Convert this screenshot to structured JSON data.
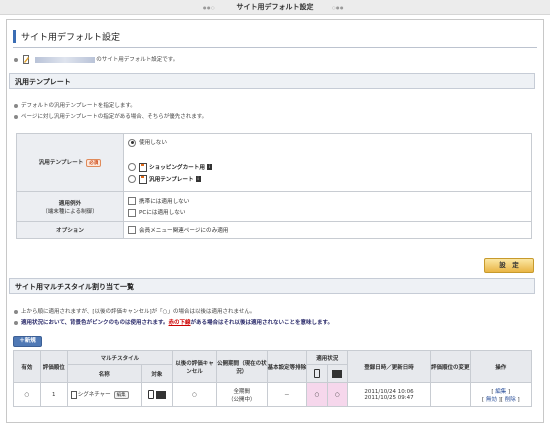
{
  "window": {
    "title": "サイト用デフォルト設定"
  },
  "main": {
    "title": "サイト用デフォルト設定",
    "intro_suffix": "のサイト用デフォルト設定です。"
  },
  "template_section": {
    "heading": "汎用テンプレート",
    "notes": [
      "デフォルトの汎用テンプレートを指定します。",
      "ページに対し汎用テンプレートの指定がある場合、そちらが優先されます。"
    ],
    "template_label": "汎用テンプレート",
    "required_badge": "必須",
    "radio_none": "使用しない",
    "radio_shopping": "ショッピングカート用",
    "radio_generic": "汎用テンプレート",
    "exclusion_label": "適用例外",
    "exclusion_sublabel": "（端末種による制御）",
    "exclude_mobile": "携帯には適用しない",
    "exclude_pc": "PCには適用しない",
    "option_label": "オプション",
    "option_text": "会員メニュー関連ページにのみ適用",
    "setting_button": "設　定"
  },
  "multistyle_section": {
    "heading": "サイト用マルチスタイル割り当て一覧",
    "note1": "上から順に適用されますが、[以後の評価キャンセル]が「○」の場合は以後は適用されません。",
    "note2_prefix": "適用状況において、背景色がピンクのものは使用されます。",
    "note2_highlight": "赤の下線",
    "note2_suffix": "がある場合はそれ以後は適用されないことを意味します。",
    "new_button": "＋新規",
    "columns": {
      "enabled": "有効",
      "order": "評価順位",
      "multistyle": "マルチスタイル",
      "name": "名称",
      "target": "対象",
      "cancel_after": "以後の評価キャンセル",
      "period": "公開期間（現在の状況）",
      "basic_block": "基本設定等排除",
      "status": "適用状況",
      "registered": "登録日時／更新日時",
      "eval_change": "評価順位の変更",
      "ops": "操作"
    },
    "rows": [
      {
        "enabled": "○",
        "order": "1",
        "name": "シグネチャー",
        "edit": "編集",
        "cancel_after": "○",
        "period_line1": "全期間",
        "period_line2": "（公開中）",
        "basic_block": "－",
        "status_mobile": "○",
        "status_pc": "○",
        "registered": "2011/10/24 10:06",
        "updated": "2011/10/25 09:47",
        "eval_change": "",
        "op_edit": "編集",
        "op_disable": "無効",
        "op_delete": "削除"
      }
    ]
  }
}
